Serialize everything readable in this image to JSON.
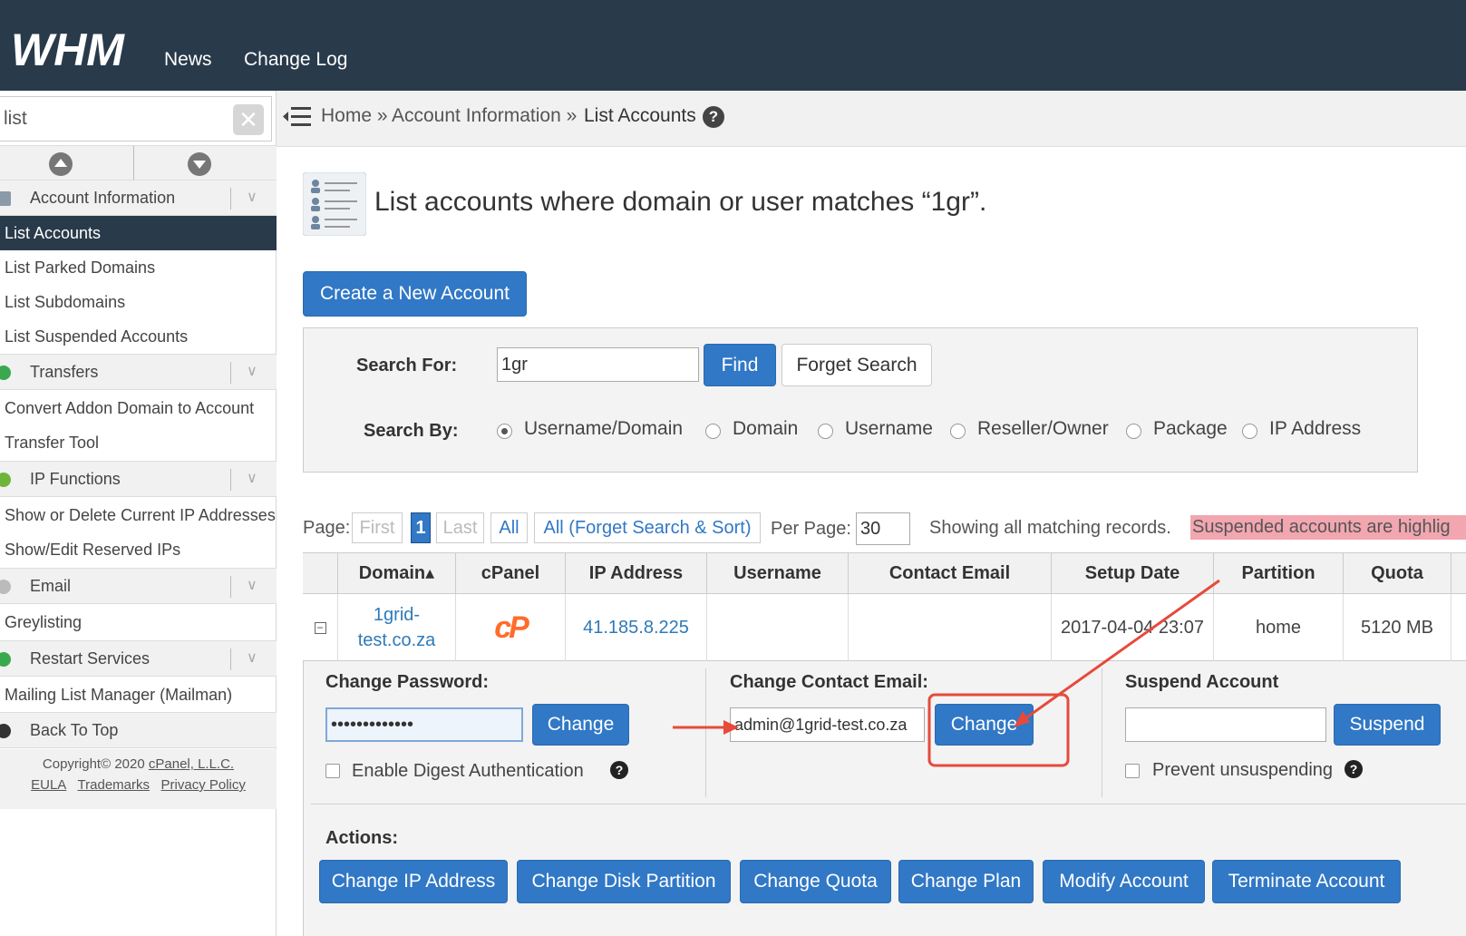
{
  "header": {
    "logo": "WHM",
    "nav": [
      "News",
      "Change Log"
    ]
  },
  "sidebar": {
    "search_value": "list",
    "footer_copyright": "Copyright© 2020",
    "footer_company": "cPanel, L.L.C.",
    "footer_links": [
      "EULA",
      "Trademarks",
      "Privacy Policy"
    ],
    "categories": [
      {
        "label": "Account Information",
        "icon": "account-icon"
      },
      {
        "label": "Transfers",
        "icon": "transfer-icon"
      },
      {
        "label": "IP Functions",
        "icon": "ip-icon"
      },
      {
        "label": "Email",
        "icon": "email-icon"
      },
      {
        "label": "Restart Services",
        "icon": "restart-icon"
      }
    ],
    "items": [
      "List Accounts",
      "List Parked Domains",
      "List Subdomains",
      "List Suspended Accounts",
      "Convert Addon Domain to Account",
      "Transfer Tool",
      "Show or Delete Current IP Addresses",
      "Show/Edit Reserved IPs",
      "Greylisting",
      "Mailing List Manager (Mailman)"
    ],
    "back_to_top": "Back To Top"
  },
  "breadcrumb": {
    "home": "Home »",
    "section": "Account Information »",
    "current": "List Accounts"
  },
  "page": {
    "title": "List accounts where domain or user matches “1gr”.",
    "create_button": "Create a New Account"
  },
  "search": {
    "label_for": "Search For:",
    "value": "1gr",
    "find_button": "Find",
    "forget_button": "Forget Search",
    "label_by": "Search By:",
    "options": [
      "Username/Domain",
      "Domain",
      "Username",
      "Reseller/Owner",
      "Package",
      "IP Address"
    ],
    "selected": "Username/Domain"
  },
  "pagination": {
    "page_label": "Page:",
    "first": "First",
    "current": "1",
    "last": "Last",
    "all": "All",
    "all_forget": "All (Forget Search & Sort)",
    "per_page_label": "Per Page:",
    "per_page_value": "30",
    "status": "Showing all matching records.",
    "suspended_note": "Suspended accounts are highlig"
  },
  "table": {
    "columns": [
      "Domain",
      "cPanel",
      "IP Address",
      "Username",
      "Contact Email",
      "Setup Date",
      "Partition",
      "Quota"
    ],
    "sort_indicator": "▴",
    "rows": [
      {
        "domain_line1": "1grid-",
        "domain_line2": "test.co.za",
        "cpanel": "cP",
        "ip": "41.185.8.225",
        "username": "",
        "contact_email": "",
        "setup_date": "2017-04-04 23:07",
        "partition": "home",
        "quota": "5120 MB"
      }
    ]
  },
  "details": {
    "change_password_label": "Change Password:",
    "password_value": "•••••••••••••",
    "change_button": "Change",
    "digest_label": "Enable Digest Authentication",
    "change_email_label": "Change Contact Email:",
    "email_value": "admin@1grid-test.co.za",
    "change_email_button": "Change",
    "suspend_label": "Suspend Account",
    "suspend_value": "",
    "suspend_button": "Suspend",
    "prevent_label": "Prevent unsuspending",
    "actions_label": "Actions:",
    "actions": [
      "Change IP Address",
      "Change Disk Partition",
      "Change Quota",
      "Change Plan",
      "Modify Account",
      "Terminate Account"
    ]
  },
  "colors": {
    "header_bg": "#293a4a",
    "accent_blue": "#3178c6",
    "highlight_red": "#e64a3b",
    "cpanel_orange": "#ff6c2c",
    "suspended_bg": "#f2a6b0"
  }
}
